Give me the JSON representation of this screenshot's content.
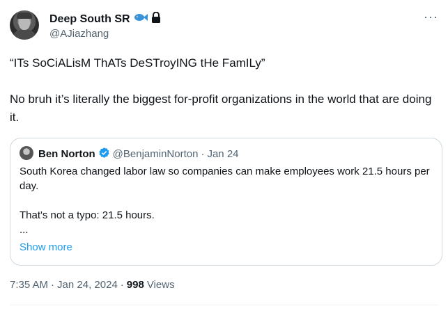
{
  "author": {
    "name": "Deep South SR",
    "handle": "@AJiazhang",
    "icons": [
      "fish-emoji-icon",
      "lock-icon"
    ]
  },
  "more_label": "···",
  "tweet": {
    "line1": "“ITs SoCiALisM ThATs DeSTroyING tHe FamILy”",
    "line2": "No bruh it’s literally the biggest for-profit organizations in the world that are doing it."
  },
  "quote": {
    "name": "Ben Norton",
    "handle": "@BenjaminNorton",
    "sep": "·",
    "date": "Jan 24",
    "text_lines": [
      "South Korea changed labor law so companies can make employees work 21.5 hours per day.",
      "That's not a typo: 21.5 hours.",
      "..."
    ],
    "show_more": "Show more"
  },
  "footer": {
    "time": "7:35 AM",
    "sep1": "·",
    "date": "Jan 24, 2024",
    "sep2": "·",
    "views_count": "998",
    "views_label": "Views"
  },
  "colors": {
    "accent": "#1d9bf0",
    "muted": "#536471",
    "text": "#0f1419",
    "border": "#cfd9de"
  }
}
